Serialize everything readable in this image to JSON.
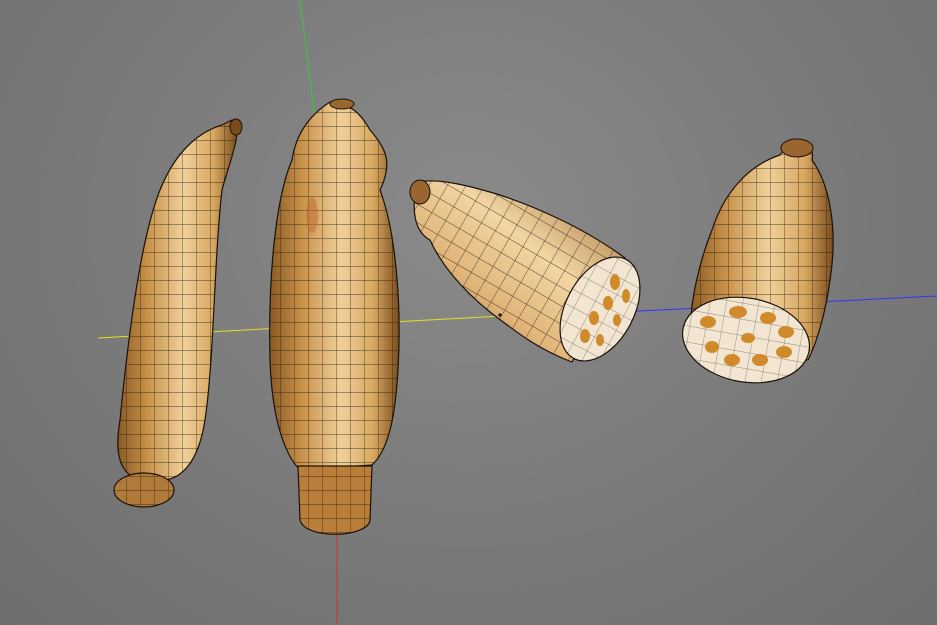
{
  "viewport": {
    "background_color": "#7d7d7d",
    "axis_colors": {
      "x_axis": "#ffff33",
      "y_axis": "#33cc33",
      "z_axis": "#3333ff",
      "neg_y_axis": "#cc3333"
    },
    "objects": [
      {
        "name": "lotus-root-whole-left",
        "material": "lotus-skin",
        "wireframe": true
      },
      {
        "name": "lotus-root-whole-center",
        "material": "lotus-skin",
        "wireframe": true
      },
      {
        "name": "lotus-root-cut-tilted",
        "material": "lotus-skin",
        "wireframe": true
      },
      {
        "name": "lotus-root-cut-upright",
        "material": "lotus-skin",
        "wireframe": true
      }
    ],
    "colors": {
      "skin_light": "#e8c48a",
      "skin_mid": "#c8924a",
      "skin_dark": "#8a5a24",
      "cut_face": "#f2e6d2",
      "hole": "#d08a2a",
      "wire": "#1a1208"
    }
  }
}
